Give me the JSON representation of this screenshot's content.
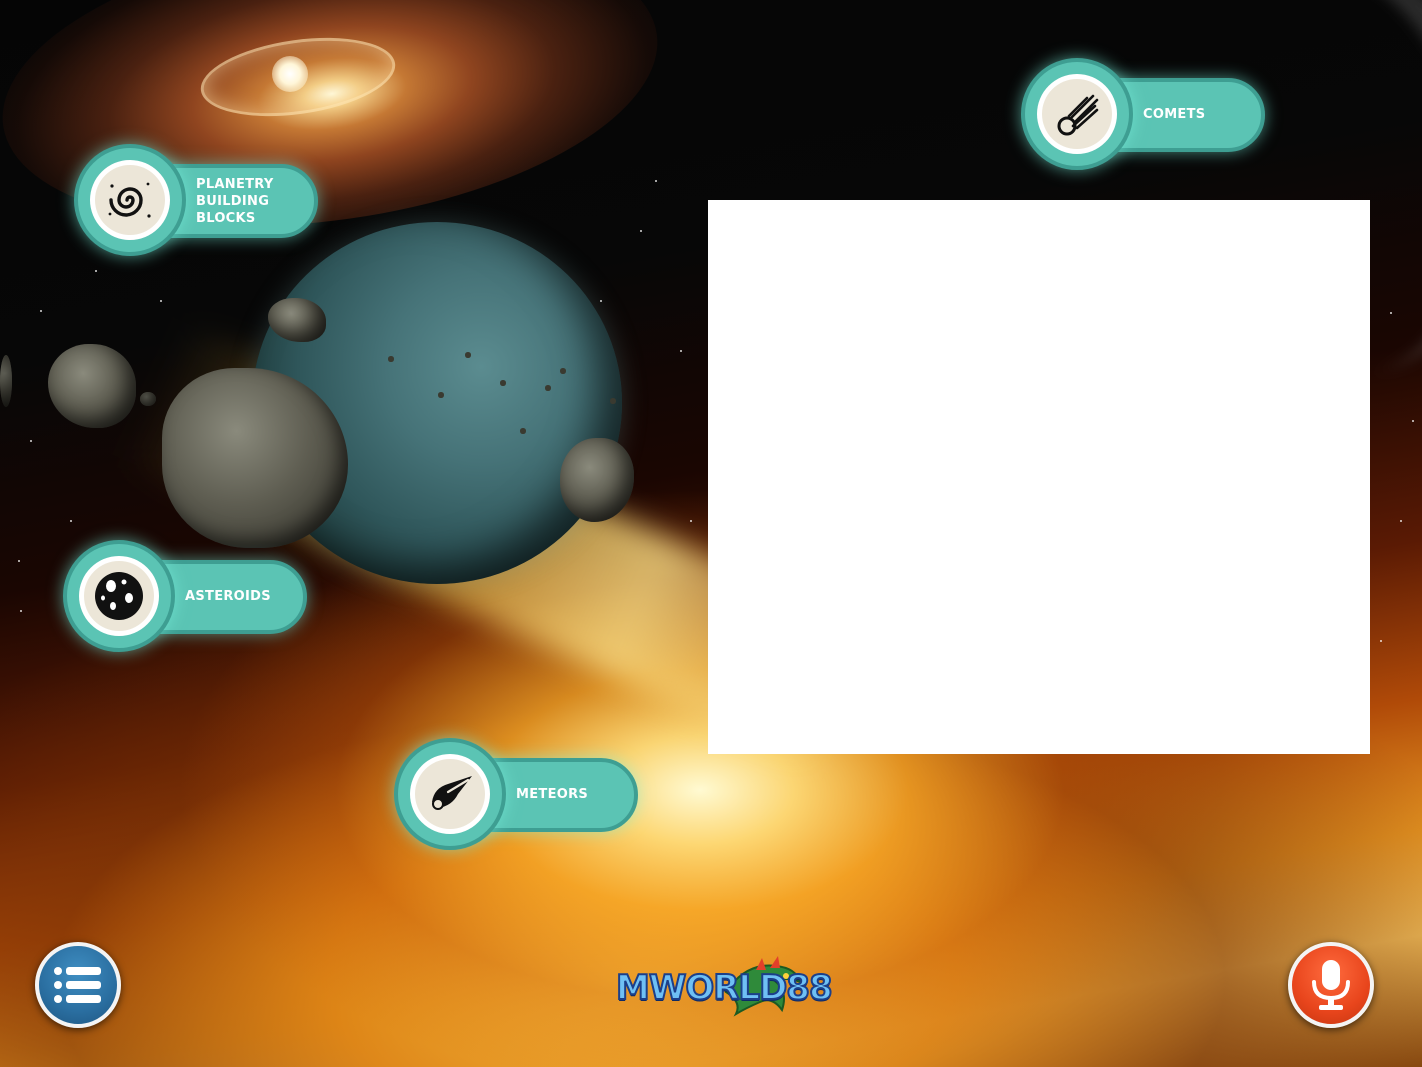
{
  "topics": {
    "planetary_building_blocks": {
      "label": "PLANETRY\nBUILDING\nBLOCKS",
      "icon": "spiral-galaxy-icon"
    },
    "comets": {
      "label": "COMETS",
      "icon": "comet-icon"
    },
    "asteroids": {
      "label": "ASTEROIDS",
      "icon": "asteroid-icon"
    },
    "meteors": {
      "label": "METEORS",
      "icon": "meteor-icon"
    }
  },
  "video_panel": {
    "state": "blank"
  },
  "controls": {
    "menu": {
      "icon": "list-menu-icon",
      "color": "#2a6ea0"
    },
    "mic": {
      "icon": "microphone-icon",
      "color": "#e8451c"
    }
  },
  "brand": {
    "logo_text": "MWORLD88"
  },
  "colors": {
    "accent": "#5bc4b4",
    "accent_border": "#3e9e92",
    "panel": "#ffffff"
  }
}
